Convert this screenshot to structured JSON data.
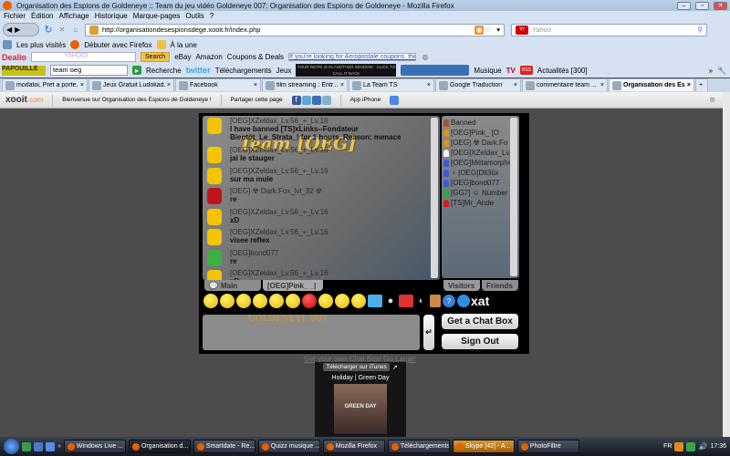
{
  "window": {
    "title": "Organisation des Espions de Goldeneye :: Team du jeu vidéo Goldeneye 007: Organisation des Espions de Goldeneye - Mozilla Firefox"
  },
  "menu": [
    "Fichier",
    "Édition",
    "Affichage",
    "Historique",
    "Marque-pages",
    "Outils",
    "?"
  ],
  "nav": {
    "url": "http://organisationdesespionsdege.xooit.fr/index.php",
    "search_placeholder": "Yahoo"
  },
  "bookmarks": [
    "Les plus visités",
    "Débuter avec Firefox",
    "À la une"
  ],
  "dealio": {
    "logo": "Dealio",
    "search_button": "Search",
    "links": [
      "eBay",
      "Amazon",
      "Coupons & Deals"
    ],
    "ad": "If you're looking for Aeropostale coupons, then"
  },
  "toolbar2": {
    "search_value": "team oeg",
    "recherche": "Recherche",
    "twitter": "twitter",
    "telechargements": "Téléchargements",
    "jeux": "Jeux",
    "player_text": "YOUR RETRI IS IN ANOTHER WINDOW · CLICK TO CALL IT BACK",
    "musique": "Musique",
    "tv": "TV",
    "actualites": "Actualités [300]"
  },
  "tabs": [
    {
      "label": "modatoi, Pret a porte...",
      "active": false
    },
    {
      "label": "Jeux Gratuit Ludokad...",
      "active": false
    },
    {
      "label": "Facebook",
      "active": false
    },
    {
      "label": "film streaming : Entr...",
      "active": false
    },
    {
      "label": "La Team TS",
      "active": false
    },
    {
      "label": "Google Traduction",
      "active": false
    },
    {
      "label": "commentaire team ...",
      "active": false
    },
    {
      "label": "Organisation des Es...",
      "active": true
    }
  ],
  "xooit": {
    "logo": "xooit",
    "logo_suffix": ".com",
    "welcome": "Bienvenue sur Organisation des Espions de Goldeneye !",
    "share": "Partager cette page",
    "app": "App iPhone"
  },
  "chat": {
    "title": "Team [OEG]",
    "messages": [
      {
        "name": "[OEG]XZeldax_Lv.56_+_Lv.16",
        "text": "I have banned [TS]xLinks--Fondateur",
        "text2": "Bientôt_Le_Strata_! for 1 hours. Reason: menace",
        "avatar": "#f5c400"
      },
      {
        "name": "[OEG]XZeldax_Lv.56_+_Lv.16",
        "text": "jai le stauger",
        "avatar": "#f5c400"
      },
      {
        "name": "[OEG]XZeldax_Lv.56_+_Lv.16",
        "text": "sur ma mule",
        "avatar": "#f5c400"
      },
      {
        "name": "[OEG] ☢ Dark.Fox_lvl_32 ☢",
        "text": "re",
        "avatar": "#c0141c"
      },
      {
        "name": "[OEG]XZeldax_Lv.56_+_Lv.16",
        "text": "xD",
        "avatar": "#f5c400"
      },
      {
        "name": "[OEG]XZeldax_Lv.56_+_Lv.16",
        "text": "visee reflex",
        "avatar": "#f5c400"
      },
      {
        "name": "[OEG]bond077",
        "text": "re",
        "avatar": "#3cb043"
      },
      {
        "name": "[OEG]XZeldax_Lv.56_+_Lv.16",
        "text": "xD",
        "avatar": "#f5c400"
      }
    ],
    "users": [
      {
        "name": "Banned",
        "color": "#a0522d"
      },
      {
        "name": "[OEG]Pink_  [O",
        "color": "#e0901a"
      },
      {
        "name": "[OEG] ☢ Dark.Fo",
        "color": "#e0901a"
      },
      {
        "name": "[OEG]XZeldax_Lv.",
        "color": "#f0f0f0"
      },
      {
        "name": "[OEG]Métamorphe",
        "color": "#3d5bd6"
      },
      {
        "name": "♀ [OEG]Dli3ûx",
        "color": "#3d5bd6"
      },
      {
        "name": "[OEG]bond077",
        "color": "#3d5bd6"
      },
      {
        "name": "[GG7] ☺ Number",
        "color": "#2ea83c"
      },
      {
        "name": "[TS]Mr_Ande",
        "color": "#d21e1e"
      }
    ],
    "tab_main": "Main",
    "tab_private": "[OEG]Pink_  _|",
    "tab_visitors": "Visitors",
    "tab_friends": "Friends",
    "get_chat_box": "Get a Chat Box",
    "sign_out": "Sign Out",
    "brand": "xat",
    "send_icon": "↵",
    "golink": "Get your own Chat Box! Go Large!"
  },
  "itunes": {
    "button": "Télécharger sur iTunes",
    "track": "Holiday | Green Day",
    "cover_text": "GREEN DAY"
  },
  "taskbar": {
    "items": [
      {
        "label": "Windows Live ...",
        "cls": ""
      },
      {
        "label": "Organisation d...",
        "cls": "active"
      },
      {
        "label": "Smartdate - Re...",
        "cls": ""
      },
      {
        "label": "Quizz musique ...",
        "cls": ""
      },
      {
        "label": "Mozilla Firefox",
        "cls": ""
      },
      {
        "label": "Téléchargements",
        "cls": ""
      },
      {
        "label": "Skype [42] - A...",
        "cls": "skype"
      },
      {
        "label": "PhotoFiltre",
        "cls": ""
      }
    ],
    "lang": "FR",
    "clock": "17:36"
  }
}
